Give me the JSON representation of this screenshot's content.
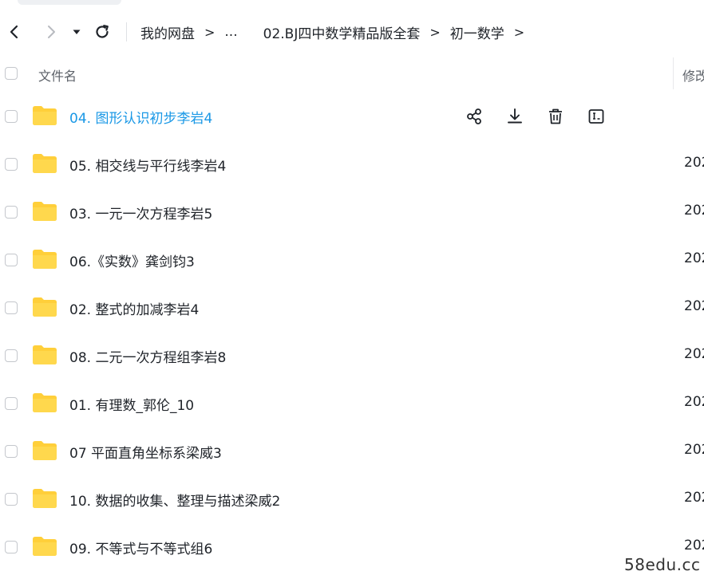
{
  "toolbar": {
    "back_icon": "chevron-left-icon",
    "forward_icon": "chevron-right-icon",
    "history_icon": "caret-down-icon",
    "refresh_icon": "refresh-icon"
  },
  "breadcrumb": {
    "root": "我的网盘",
    "ellipsis": "...",
    "level1": "02.BJ四中数学精品版全套",
    "level2": "初一数学",
    "separator": ">"
  },
  "table": {
    "col_name": "文件名",
    "col_modified": "修改"
  },
  "row_actions": [
    "share-icon",
    "download-icon",
    "delete-icon",
    "rename-icon"
  ],
  "files": [
    {
      "name": "04. 图形认识初步李岩4",
      "date": ""
    },
    {
      "name": "05. 相交线与平行线李岩4",
      "date": "202"
    },
    {
      "name": "03. 一元一次方程李岩5",
      "date": "202"
    },
    {
      "name": "06.《实数》龚剑钧3",
      "date": "202"
    },
    {
      "name": "02. 整式的加减李岩4",
      "date": "202"
    },
    {
      "name": "08. 二元一次方程组李岩8",
      "date": "202"
    },
    {
      "name": "01. 有理数_郭伦_10",
      "date": "202"
    },
    {
      "name": "07 平面直角坐标系梁威3",
      "date": "202"
    },
    {
      "name": "10. 数据的收集、整理与描述梁威2",
      "date": "202"
    },
    {
      "name": "09. 不等式与不等式组6",
      "date": "202"
    }
  ],
  "watermark": "58edu.cc",
  "colors": {
    "accent": "#1a98e6",
    "folder": "#ffcf3a"
  }
}
